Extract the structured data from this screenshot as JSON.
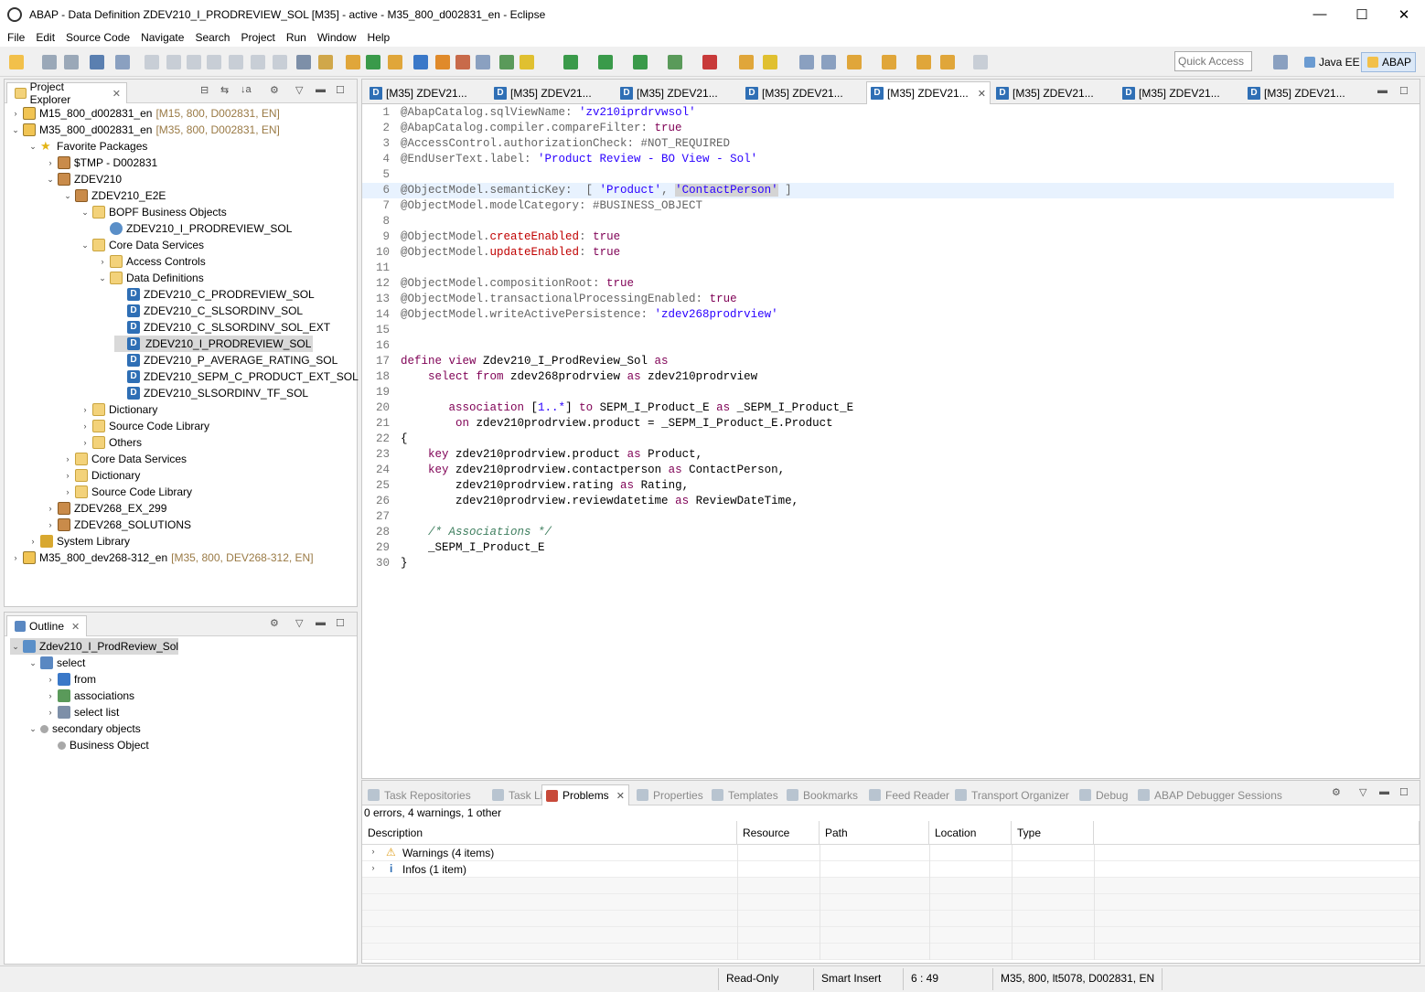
{
  "window": {
    "title": "ABAP - Data Definition ZDEV210_I_PRODREVIEW_SOL [M35] - active - M35_800_d002831_en - Eclipse",
    "minimize": "—",
    "maximize": "☐",
    "close": "✕"
  },
  "menu": [
    "File",
    "Edit",
    "Source Code",
    "Navigate",
    "Search",
    "Project",
    "Run",
    "Window",
    "Help"
  ],
  "quick_access": {
    "placeholder": "Quick Access"
  },
  "perspectives": {
    "java_ee": "Java EE",
    "abap": "ABAP"
  },
  "project_explorer": {
    "title": "Project Explorer",
    "rows": [
      {
        "label": "M15_800_d002831_en",
        "extra": "[M15, 800, D002831, EN]"
      },
      {
        "label": "M35_800_d002831_en",
        "extra": "[M35, 800, D002831, EN]"
      },
      {
        "label": "Favorite Packages"
      },
      {
        "label": "$TMP - D002831"
      },
      {
        "label": "ZDEV210"
      },
      {
        "label": "ZDEV210_E2E"
      },
      {
        "label": "BOPF Business Objects"
      },
      {
        "label": "ZDEV210_I_PRODREVIEW_SOL"
      },
      {
        "label": "Core Data Services"
      },
      {
        "label": "Access Controls"
      },
      {
        "label": "Data Definitions"
      },
      {
        "label": "ZDEV210_C_PRODREVIEW_SOL"
      },
      {
        "label": "ZDEV210_C_SLSORDINV_SOL"
      },
      {
        "label": "ZDEV210_C_SLSORDINV_SOL_EXT"
      },
      {
        "label": "ZDEV210_I_PRODREVIEW_SOL"
      },
      {
        "label": "ZDEV210_P_AVERAGE_RATING_SOL"
      },
      {
        "label": "ZDEV210_SEPM_C_PRODUCT_EXT_SOL"
      },
      {
        "label": "ZDEV210_SLSORDINV_TF_SOL"
      },
      {
        "label": "Dictionary"
      },
      {
        "label": "Source Code Library"
      },
      {
        "label": "Others"
      },
      {
        "label": "Core Data Services"
      },
      {
        "label": "Dictionary"
      },
      {
        "label": "Source Code Library"
      },
      {
        "label": "ZDEV268_EX_299"
      },
      {
        "label": "ZDEV268_SOLUTIONS"
      },
      {
        "label": "System Library"
      },
      {
        "label": "M35_800_dev268-312_en",
        "extra": "[M35, 800, DEV268-312, EN]"
      }
    ]
  },
  "outline": {
    "title": "Outline",
    "rows": [
      {
        "label": "Zdev210_I_ProdReview_Sol"
      },
      {
        "label": "select"
      },
      {
        "label": "from"
      },
      {
        "label": "associations"
      },
      {
        "label": "select list"
      },
      {
        "label": "secondary objects"
      },
      {
        "label": "Business Object"
      }
    ]
  },
  "editor": {
    "tabs": [
      "[M35] ZDEV21...",
      "[M35] ZDEV21...",
      "[M35] ZDEV21...",
      "[M35] ZDEV21...",
      "[M35] ZDEV21...",
      "[M35] ZDEV21...",
      "[M35] ZDEV21...",
      "[M35] ZDEV21..."
    ],
    "lines": [
      {
        "n": "1",
        "parts": [
          [
            "ann",
            "@AbapCatalog.sqlViewName: "
          ],
          [
            "str",
            "'zv210iprdrvwsol'"
          ]
        ]
      },
      {
        "n": "2",
        "parts": [
          [
            "ann",
            "@AbapCatalog.compiler.compareFilter: "
          ],
          [
            "kw",
            "true"
          ]
        ]
      },
      {
        "n": "3",
        "parts": [
          [
            "ann",
            "@AccessControl.authorizationCheck: #NOT_REQUIRED"
          ]
        ]
      },
      {
        "n": "4",
        "parts": [
          [
            "ann",
            "@EndUserText.label: "
          ],
          [
            "str",
            "'Product Review - BO View - Sol'"
          ]
        ]
      },
      {
        "n": "5",
        "parts": []
      },
      {
        "n": "6",
        "parts": [
          [
            "ann",
            "@ObjectModel.semanticKey:  [ "
          ],
          [
            "str",
            "'Product'"
          ],
          [
            "ann",
            ", "
          ],
          [
            "str",
            "'ContactPerson'"
          ],
          [
            "ann",
            " ]"
          ]
        ]
      },
      {
        "n": "7",
        "parts": [
          [
            "ann",
            "@ObjectModel.modelCategory: #BUSINESS_OBJECT"
          ]
        ]
      },
      {
        "n": "8",
        "parts": []
      },
      {
        "n": "9",
        "parts": [
          [
            "ann",
            "@ObjectModel."
          ],
          [
            "red",
            "createEnabled"
          ],
          [
            "ann",
            ": "
          ],
          [
            "kw",
            "true"
          ]
        ]
      },
      {
        "n": "10",
        "parts": [
          [
            "ann",
            "@ObjectModel."
          ],
          [
            "red",
            "updateEnabled"
          ],
          [
            "ann",
            ": "
          ],
          [
            "kw",
            "true"
          ]
        ]
      },
      {
        "n": "11",
        "parts": []
      },
      {
        "n": "12",
        "parts": [
          [
            "ann",
            "@ObjectModel.compositionRoot: "
          ],
          [
            "kw",
            "true"
          ]
        ]
      },
      {
        "n": "13",
        "parts": [
          [
            "ann",
            "@ObjectModel.transactionalProcessingEnabled: "
          ],
          [
            "kw",
            "true"
          ]
        ]
      },
      {
        "n": "14",
        "parts": [
          [
            "ann",
            "@ObjectModel.writeActivePersistence: "
          ],
          [
            "str",
            "'zdev268prodrview'"
          ]
        ]
      },
      {
        "n": "15",
        "parts": []
      },
      {
        "n": "16",
        "parts": []
      },
      {
        "n": "17",
        "parts": [
          [
            "kw",
            "define view "
          ],
          [
            "blk",
            "Zdev210_I_ProdReview_Sol "
          ],
          [
            "kw",
            "as"
          ]
        ]
      },
      {
        "n": "18",
        "parts": [
          [
            "blk",
            "    "
          ],
          [
            "kw",
            "select from "
          ],
          [
            "blk",
            "zdev268prodrview "
          ],
          [
            "kw",
            "as "
          ],
          [
            "blk",
            "zdev210prodrview"
          ]
        ]
      },
      {
        "n": "19",
        "parts": []
      },
      {
        "n": "20",
        "parts": [
          [
            "blk",
            "       "
          ],
          [
            "kw",
            "association "
          ],
          [
            "blk",
            "["
          ],
          [
            "str",
            "1..*"
          ],
          [
            "blk",
            "] "
          ],
          [
            "kw",
            "to "
          ],
          [
            "blk",
            "SEPM_I_Product_E "
          ],
          [
            "kw",
            "as "
          ],
          [
            "blk",
            "_SEPM_I_Product_E"
          ]
        ]
      },
      {
        "n": "21",
        "parts": [
          [
            "blk",
            "        "
          ],
          [
            "kw",
            "on "
          ],
          [
            "blk",
            "zdev210prodrview.product = _SEPM_I_Product_E.Product"
          ]
        ]
      },
      {
        "n": "22",
        "parts": [
          [
            "blk",
            "{"
          ]
        ]
      },
      {
        "n": "23",
        "parts": [
          [
            "blk",
            "    "
          ],
          [
            "kw",
            "key "
          ],
          [
            "blk",
            "zdev210prodrview.product "
          ],
          [
            "kw",
            "as "
          ],
          [
            "blk",
            "Product,"
          ]
        ]
      },
      {
        "n": "24",
        "parts": [
          [
            "blk",
            "    "
          ],
          [
            "kw",
            "key "
          ],
          [
            "blk",
            "zdev210prodrview.contactperson "
          ],
          [
            "kw",
            "as "
          ],
          [
            "blk",
            "ContactPerson,"
          ]
        ]
      },
      {
        "n": "25",
        "parts": [
          [
            "blk",
            "        zdev210prodrview.rating "
          ],
          [
            "kw",
            "as "
          ],
          [
            "blk",
            "Rating,"
          ]
        ]
      },
      {
        "n": "26",
        "parts": [
          [
            "blk",
            "        zdev210prodrview.reviewdatetime "
          ],
          [
            "kw",
            "as "
          ],
          [
            "blk",
            "ReviewDateTime,"
          ]
        ]
      },
      {
        "n": "27",
        "parts": []
      },
      {
        "n": "28",
        "parts": [
          [
            "blk",
            "    "
          ],
          [
            "cmt",
            "/* Associations */"
          ]
        ]
      },
      {
        "n": "29",
        "parts": [
          [
            "blk",
            "    _SEPM_I_Product_E"
          ]
        ]
      },
      {
        "n": "30",
        "parts": [
          [
            "blk",
            "}"
          ]
        ]
      }
    ]
  },
  "bottom": {
    "tabs": [
      "Task Repositories",
      "Task List",
      "Problems",
      "Properties",
      "Templates",
      "Bookmarks",
      "Feed Reader",
      "Transport Organizer",
      "Debug",
      "ABAP Debugger Sessions"
    ],
    "summary": "0 errors, 4 warnings, 1 other",
    "columns": [
      "Description",
      "Resource",
      "Path",
      "Location",
      "Type"
    ],
    "rows": [
      "Warnings (4 items)",
      "Infos (1 item)"
    ]
  },
  "status": {
    "mode": "Read-Only",
    "insert": "Smart Insert",
    "position": "6 : 49",
    "system": "M35, 800, lt5078, D002831, EN"
  }
}
